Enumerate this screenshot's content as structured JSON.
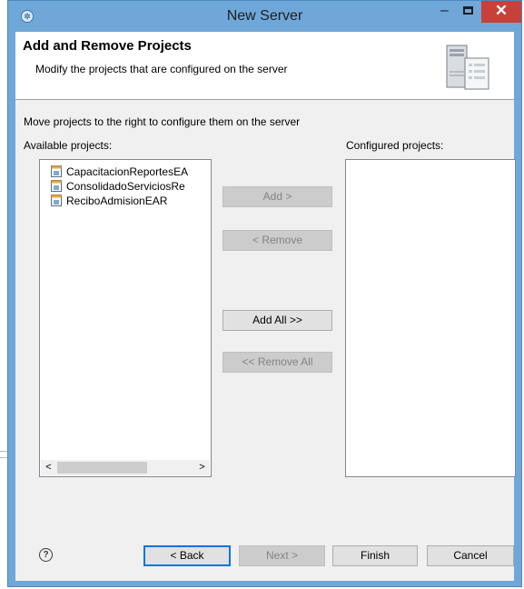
{
  "window": {
    "title": "New Server",
    "minimize_glyph": "–",
    "close_glyph": "✕",
    "app_icon": "eclipse-gear-icon"
  },
  "header": {
    "title": "Add and Remove Projects",
    "description": "Modify the projects that are configured on the server",
    "art_icon": "server-wizard-icon"
  },
  "instructions": "Move projects to the right to configure them on the server",
  "available": {
    "label": "Available projects:",
    "items": [
      {
        "label": "CapacitacionReportesEA",
        "icon": "ear-project-icon"
      },
      {
        "label": "ConsolidadoServiciosRe",
        "icon": "ear-project-icon"
      },
      {
        "label": "ReciboAdmisionEAR",
        "icon": "ear-project-icon"
      }
    ],
    "scroll_left": "<",
    "scroll_right": ">"
  },
  "configured": {
    "label": "Configured projects:",
    "items": []
  },
  "move_buttons": {
    "add": "Add >",
    "remove": "< Remove",
    "add_all": "Add All >>",
    "remove_all": "<< Remove All"
  },
  "footer": {
    "help": "?",
    "back": "< Back",
    "next": "Next >",
    "finish": "Finish",
    "cancel": "Cancel"
  },
  "colors": {
    "window_frame": "#6fa7d9",
    "close_button": "#c7403a",
    "dialog_bg": "#f0f0f0",
    "disabled_button": "#cccccc",
    "default_button_border": "#0078d7"
  }
}
